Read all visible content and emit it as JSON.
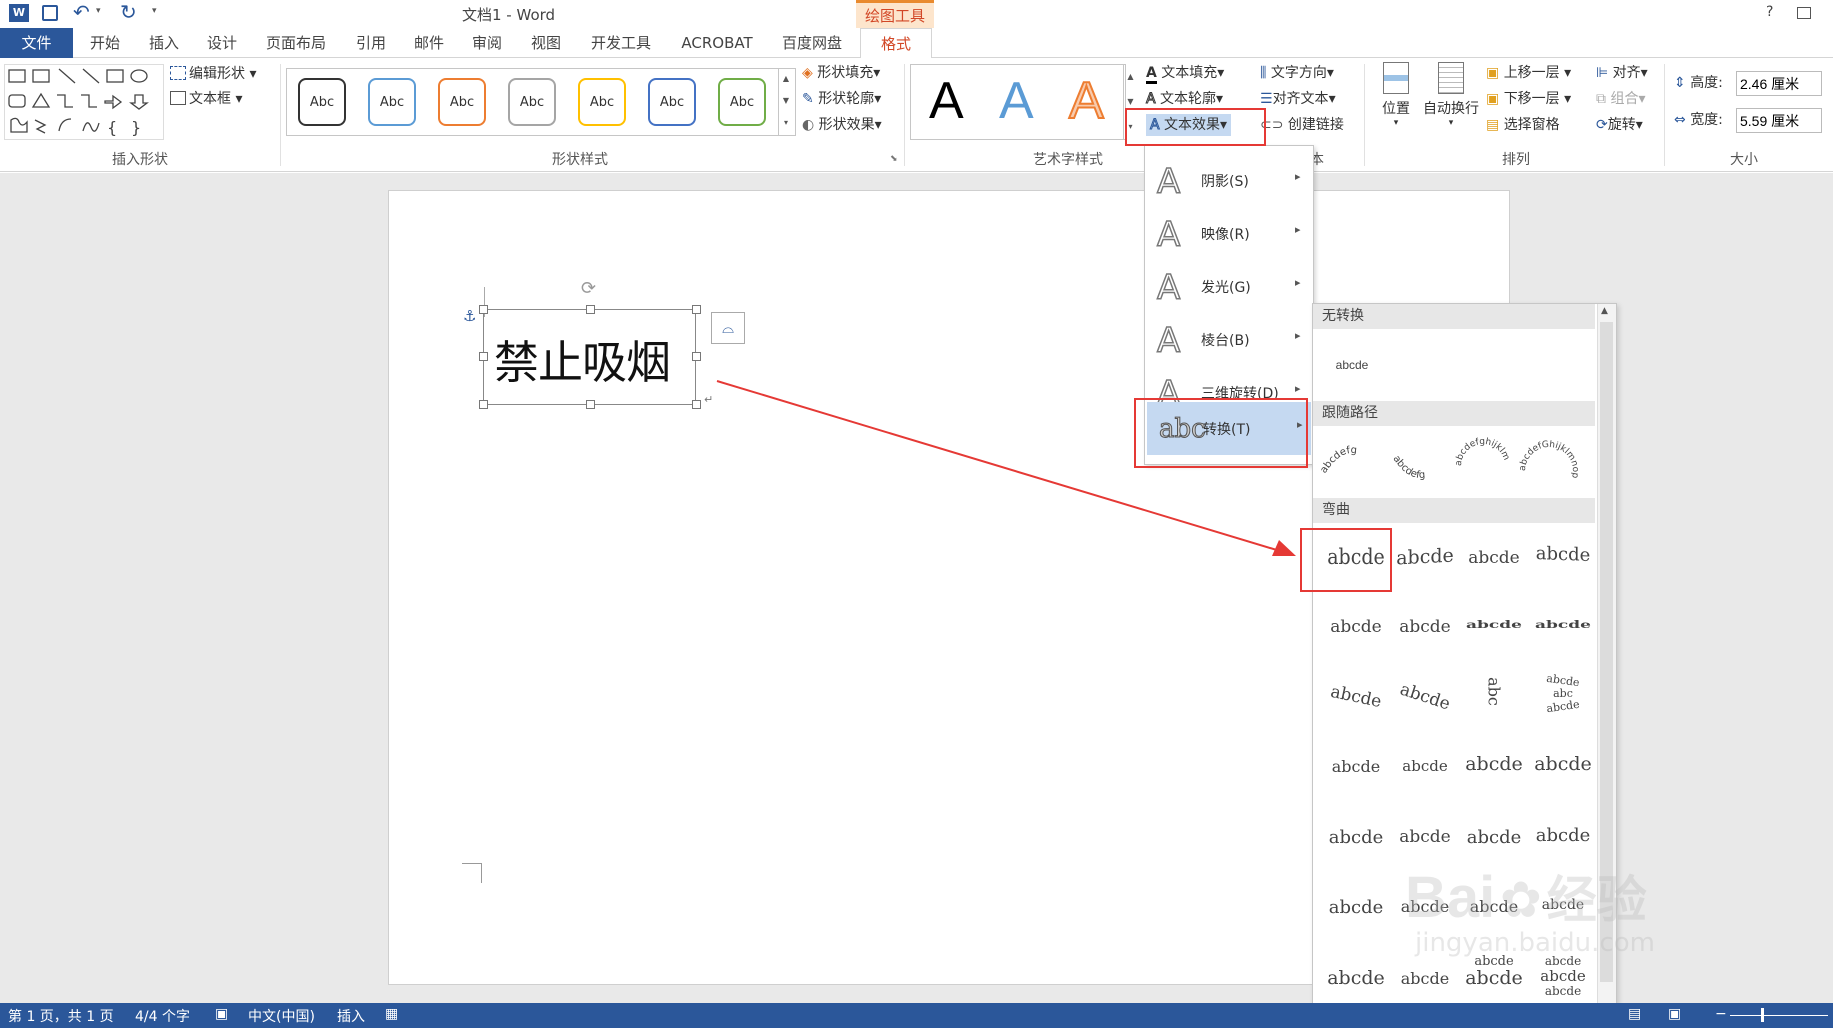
{
  "window": {
    "title": "文档1 - Word",
    "context_tool": "绘图工具",
    "help": "?"
  },
  "tabs": [
    "开始",
    "插入",
    "设计",
    "页面布局",
    "引用",
    "邮件",
    "审阅",
    "视图",
    "开发工具",
    "ACROBAT",
    "百度网盘"
  ],
  "file_tab": "文件",
  "format_tab": "格式",
  "ribbon": {
    "insert_shapes": {
      "edit_shape": "编辑形状",
      "text_box": "文本框",
      "label": "插入形状"
    },
    "shape_styles": {
      "swatch_text": "Abc",
      "fill": "形状填充",
      "outline": "形状轮廓",
      "effects": "形状效果",
      "label": "形状样式"
    },
    "wordart": {
      "letter": "A",
      "text_fill": "文本填充",
      "text_outline": "文本轮廓",
      "text_effects": "文本效果",
      "label": "艺术字样式"
    },
    "text": {
      "direction": "文字方向",
      "align": "对齐文本",
      "link": "创建链接",
      "label_partial": "本"
    },
    "arrange": {
      "position": "位置",
      "wrap": "自动换行",
      "bring_forward": "上移一层",
      "send_backward": "下移一层",
      "selection_pane": "选择窗格",
      "align": "对齐",
      "group": "组合",
      "rotate": "旋转",
      "label": "排列"
    },
    "size": {
      "height_label": "高度:",
      "height_value": "2.46 厘米",
      "width_label": "宽度:",
      "width_value": "5.59 厘米",
      "label": "大小"
    }
  },
  "document": {
    "textbox_text": "禁止吸烟"
  },
  "text_effects_menu": [
    {
      "label": "阴影(S)"
    },
    {
      "label": "映像(R)"
    },
    {
      "label": "发光(G)"
    },
    {
      "label": "棱台(B)"
    },
    {
      "label": "三维旋转(D)"
    },
    {
      "label": "转换(T)"
    }
  ],
  "transform_gallery": {
    "no_transform_header": "无转换",
    "no_transform_sample": "abcde",
    "follow_path_header": "跟随路径",
    "follow_path_samples": [
      "abcdefg",
      "abcdefg",
      "abcdefghijklm",
      "abcdefGhijklmnop"
    ],
    "warp_header": "弯曲",
    "warp_sample": "abcde",
    "warp_extra_samples": [
      "abc",
      "abcde",
      "abcde"
    ]
  },
  "statusbar": {
    "page": "第 1 页，共 1 页",
    "words": "4/4 个字",
    "language": "中文(中国)",
    "mode": "插入"
  },
  "watermark": {
    "brand": "Bai",
    "brand2": "经验",
    "url": "jingyan.baidu.com"
  },
  "colors": {
    "accent": "#2b579a",
    "highlight": "#e53935",
    "format_tab": "#d24726",
    "menu_selected": "#c5d9f1"
  }
}
